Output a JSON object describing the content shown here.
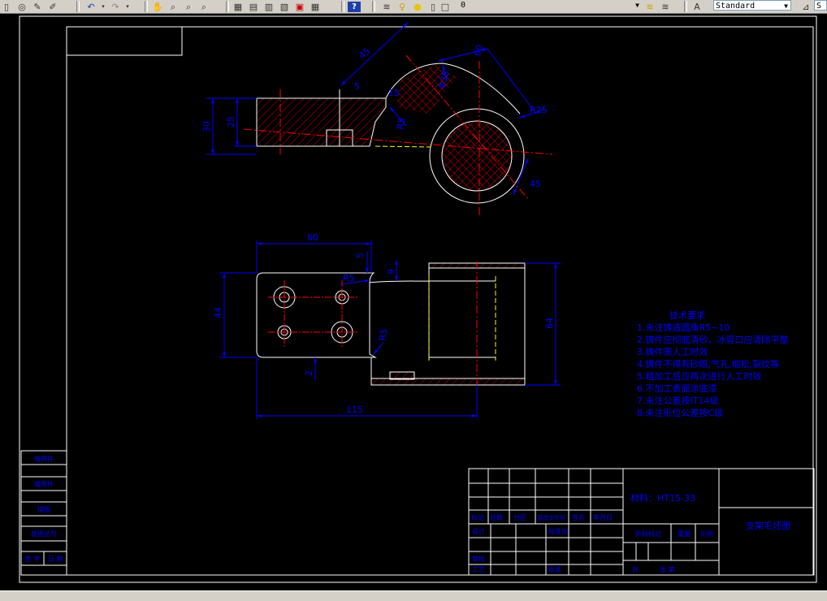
{
  "toolbar": {
    "layer_value": "0",
    "text_style": "Standard",
    "dim_style": "S",
    "icons": [
      "open-icon",
      "publish-icon",
      "pen-icon",
      "brush-icon",
      "undo-icon",
      "redo-icon",
      "pan-icon",
      "zoom-realtime-icon",
      "zoom-window-icon",
      "zoom-previous-icon",
      "properties-icon",
      "designcenter-icon",
      "tool-palettes-icon",
      "sheet-set-icon",
      "markup-icon",
      "calculator-icon",
      "help-icon",
      "layer-manager-icon",
      "layer-state-icon",
      "layers-icon",
      "dim-style-icon"
    ]
  },
  "colors": {
    "background": "#000000",
    "frame": "#ffffff",
    "outline": "#ffffff",
    "dimension": "#0000ff",
    "hatch": "#ff0000",
    "center": "#ff0000",
    "hidden": "#ffff00",
    "tech_text": "#0000ff"
  },
  "dimensions": {
    "top": [
      "45",
      "60",
      "15",
      "5",
      "Φ38",
      "R5",
      "R25",
      "30",
      "25",
      "45"
    ],
    "front": [
      "60",
      "5",
      "R5",
      "9",
      "44",
      "64",
      "R5",
      "2",
      "115"
    ]
  },
  "tech_requirements": {
    "title": "技术要求",
    "items": [
      "1.未注铸造圆角R5~10",
      "2.铸件应彻底清砂，冰冒口应清除平整",
      "3.铸件需人工时效",
      "4.铸件不得有砂眼,气孔,缩松,裂纹等",
      "5.粗加工后应再次进行人工时效",
      "6.不加工表面涂底漆",
      "7.未注公差按IT14级",
      "8.未注形位公差按C级"
    ]
  },
  "title_block": {
    "material": "材料：HT15-33",
    "drawing_name": "支架毛坯图",
    "headers": [
      "标记",
      "处数",
      "分区",
      "更改文件号",
      "签名",
      "年月日"
    ],
    "row_design": "设计",
    "row_standard": "标准化",
    "row_check": "审核",
    "row_craft": "工艺",
    "row_approve": "批准",
    "stage": "阶段标记",
    "weight": "重量",
    "scale": "比例",
    "sheets": "共",
    "sheet": "张 第"
  },
  "side_block": {
    "labels": [
      "借用件",
      "借用件",
      "描图",
      "底图总号",
      "签 字",
      "日 期",
      "签字",
      "日期"
    ]
  }
}
